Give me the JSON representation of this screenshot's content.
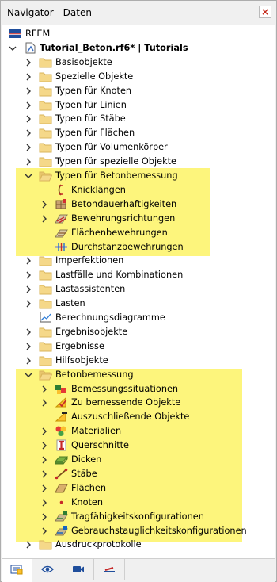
{
  "window": {
    "title": "Navigator - Daten",
    "close_glyph": "×"
  },
  "colors": {
    "highlight": "#fdf57c",
    "folder": "#f5d889",
    "folder_edge": "#d9b45a"
  },
  "tree": [
    {
      "label": "RFEM",
      "icon": "rfem-logo-icon",
      "chevron": "none"
    },
    {
      "label": "Tutorial_Beton.rf6* | Tutorials",
      "icon": "model-file-icon",
      "chevron": "expanded",
      "bold": true
    },
    {
      "label": "Basisobjekte",
      "icon": "folder-icon",
      "chevron": "collapsed"
    },
    {
      "label": "Spezielle Objekte",
      "icon": "folder-icon",
      "chevron": "collapsed"
    },
    {
      "label": "Typen für Knoten",
      "icon": "folder-icon",
      "chevron": "collapsed"
    },
    {
      "label": "Typen für Linien",
      "icon": "folder-icon",
      "chevron": "collapsed"
    },
    {
      "label": "Typen für Stäbe",
      "icon": "folder-icon",
      "chevron": "collapsed"
    },
    {
      "label": "Typen für Flächen",
      "icon": "folder-icon",
      "chevron": "collapsed"
    },
    {
      "label": "Typen für Volumenkörper",
      "icon": "folder-icon",
      "chevron": "collapsed"
    },
    {
      "label": "Typen für spezielle Objekte",
      "icon": "folder-icon",
      "chevron": "collapsed"
    },
    {
      "label": "Typen für Betonbemessung",
      "icon": "open-folder-icon",
      "chevron": "expanded"
    },
    {
      "label": "Knicklängen",
      "icon": "buckling-length-icon",
      "chevron": "none"
    },
    {
      "label": "Betondauerhaftigkeiten",
      "icon": "durability-icon",
      "chevron": "collapsed"
    },
    {
      "label": "Bewehrungsrichtungen",
      "icon": "reinforcement-direction-icon",
      "chevron": "collapsed"
    },
    {
      "label": "Flächenbewehrungen",
      "icon": "surface-reinforcement-icon",
      "chevron": "none"
    },
    {
      "label": "Durchstanzbewehrungen",
      "icon": "punching-reinforcement-icon",
      "chevron": "none"
    },
    {
      "label": "Imperfektionen",
      "icon": "folder-icon",
      "chevron": "collapsed"
    },
    {
      "label": "Lastfälle und Kombinationen",
      "icon": "folder-icon",
      "chevron": "collapsed"
    },
    {
      "label": "Lastassistenten",
      "icon": "folder-icon",
      "chevron": "collapsed"
    },
    {
      "label": "Lasten",
      "icon": "folder-icon",
      "chevron": "collapsed"
    },
    {
      "label": "Berechnungsdiagramme",
      "icon": "calculation-diagram-icon",
      "chevron": "none"
    },
    {
      "label": "Ergebnisobjekte",
      "icon": "folder-icon",
      "chevron": "collapsed"
    },
    {
      "label": "Ergebnisse",
      "icon": "folder-icon",
      "chevron": "collapsed"
    },
    {
      "label": "Hilfsobjekte",
      "icon": "folder-icon",
      "chevron": "collapsed"
    },
    {
      "label": "Betonbemessung",
      "icon": "open-folder-icon",
      "chevron": "expanded"
    },
    {
      "label": "Bemessungssituationen",
      "icon": "design-situation-icon",
      "chevron": "collapsed"
    },
    {
      "label": "Zu bemessende Objekte",
      "icon": "objects-to-design-icon",
      "chevron": "collapsed"
    },
    {
      "label": "Auszuschließende Objekte",
      "icon": "excluded-objects-icon",
      "chevron": "none"
    },
    {
      "label": "Materialien",
      "icon": "materials-icon",
      "chevron": "collapsed"
    },
    {
      "label": "Querschnitte",
      "icon": "cross-section-icon",
      "chevron": "collapsed"
    },
    {
      "label": "Dicken",
      "icon": "thickness-icon",
      "chevron": "collapsed"
    },
    {
      "label": "Stäbe",
      "icon": "member-icon",
      "chevron": "collapsed"
    },
    {
      "label": "Flächen",
      "icon": "surface-icon",
      "chevron": "collapsed"
    },
    {
      "label": "Knoten",
      "icon": "node-icon",
      "chevron": "collapsed"
    },
    {
      "label": "Tragfähigkeitskonfigurationen",
      "icon": "uls-configuration-icon",
      "chevron": "collapsed"
    },
    {
      "label": "Gebrauchstauglichkeitskonfigurationen",
      "icon": "sls-configuration-icon",
      "chevron": "collapsed"
    },
    {
      "label": "Ausdruckprotokolle",
      "icon": "folder-icon",
      "chevron": "collapsed"
    }
  ],
  "tabs": [
    {
      "name": "data-tab",
      "icon": "data-navigator-icon",
      "active": true
    },
    {
      "name": "display-tab",
      "icon": "eye-icon",
      "active": false
    },
    {
      "name": "views-tab",
      "icon": "video-camera-icon",
      "active": false
    },
    {
      "name": "results-tab",
      "icon": "results-icon",
      "active": false
    }
  ]
}
